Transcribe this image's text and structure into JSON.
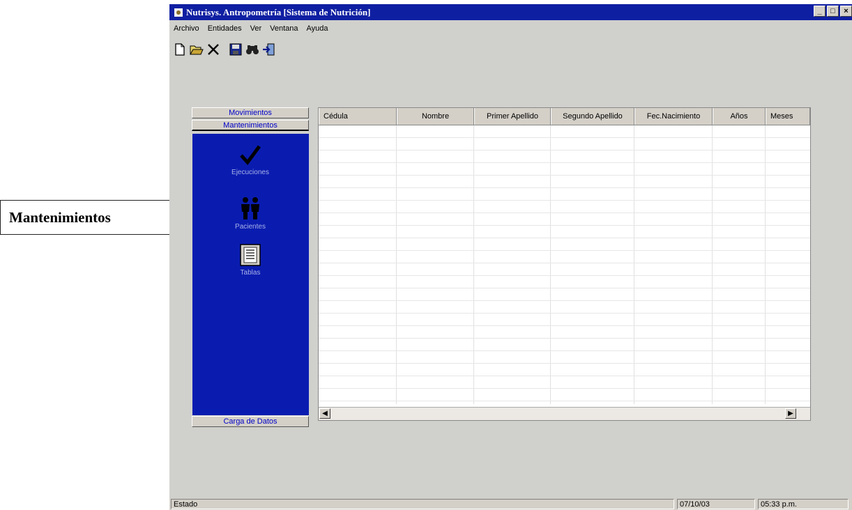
{
  "window": {
    "title": "Nutrisys. Antropometría [Sistema de Nutrición]",
    "controls": {
      "minimize": "_",
      "maximize": "□",
      "close": "×"
    }
  },
  "menu": {
    "items": [
      "Archivo",
      "Entidades",
      "Ver",
      "Ventana",
      "Ayuda"
    ]
  },
  "toolbar": {
    "icons": [
      "new-icon",
      "open-icon",
      "delete-icon",
      "save-icon",
      "find-icon",
      "exit-icon"
    ]
  },
  "sidebar": {
    "tabs": {
      "movimientos": "Movimientos",
      "mantenimientos": "Mantenimientos",
      "carga": "Carga de Datos"
    },
    "items": [
      {
        "label": "Ejecuciones",
        "icon": "checkmark-icon"
      },
      {
        "label": "Pacientes",
        "icon": "people-icon"
      },
      {
        "label": "Tablas",
        "icon": "table-icon"
      }
    ],
    "panel_color": "#0a1cb0"
  },
  "grid": {
    "columns": [
      "Cédula",
      "Nombre",
      "Primer Apellido",
      "Segundo Apellido",
      "Fec.Nacimiento",
      "Años",
      "Meses"
    ]
  },
  "status": {
    "label": "Estado",
    "date": "07/10/03",
    "time": "05:33 p.m."
  },
  "annotation": {
    "label": "Mantenimientos",
    "bracket_color": "#b01020"
  },
  "colors": {
    "titlebar": "#0f1fa2",
    "tab_text": "#0000c8",
    "window_bg": "#d0d0cc"
  }
}
